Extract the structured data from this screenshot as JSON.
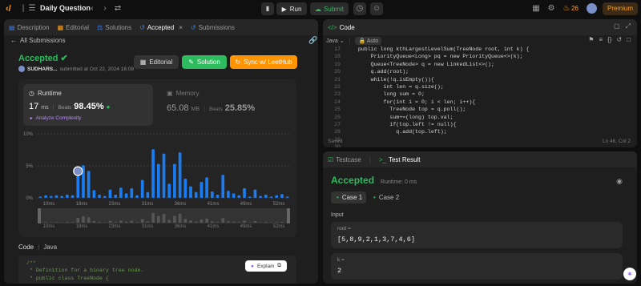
{
  "nav": {
    "title": "Daily Question",
    "run": "Run",
    "submit": "Submit",
    "streak": "26",
    "premium": "Premium"
  },
  "left_tabs": [
    {
      "label": "Description"
    },
    {
      "label": "Editorial"
    },
    {
      "label": "Solutions"
    },
    {
      "label": "Accepted"
    },
    {
      "label": "Submissions"
    }
  ],
  "submission": {
    "back_label": "All Submissions",
    "status": "Accepted",
    "user": "SUDHARS...",
    "submitted": "submitted at Oct 22, 2024 16:08",
    "editorial_btn": "Editorial",
    "solution_btn": "Solution",
    "sync_btn": "Sync w/ LeetHub"
  },
  "runtime": {
    "label": "Runtime",
    "value": "17",
    "unit": "ms",
    "beats_label": "Beats",
    "beats": "98.45%",
    "analyze": "Analyze Complexity"
  },
  "memory": {
    "label": "Memory",
    "value": "65.08",
    "unit": "MB",
    "beats_label": "Beats",
    "beats": "25.85%"
  },
  "chart_data": {
    "type": "bar",
    "ytick_labels": [
      "10%",
      "5%",
      "0%"
    ],
    "ylim": [
      0,
      10
    ],
    "xtick_labels": [
      "10ms",
      "18ms",
      "23ms",
      "31ms",
      "36ms",
      "41ms",
      "49ms",
      "52ms"
    ],
    "values": [
      0.2,
      0.4,
      0.3,
      0.4,
      0.3,
      0.5,
      0.4,
      3.8,
      5.1,
      4.2,
      1.2,
      0.5,
      0.3,
      1.3,
      0.5,
      1.6,
      0.7,
      1.5,
      0.4,
      2.8,
      0.9,
      7.6,
      5.3,
      6.9,
      2.2,
      5.3,
      7.1,
      3.0,
      1.8,
      0.9,
      2.5,
      3.2,
      1.0,
      0.5,
      3.6,
      1.1,
      0.7,
      0.4,
      1.5,
      0.2,
      1.3,
      0.3,
      0.5,
      0.2,
      0.4,
      0.6,
      0.2
    ],
    "highlight_index": 7
  },
  "code_section": {
    "label": "Code",
    "lang": "Java",
    "explain": "Explain",
    "lines": [
      "/**",
      " * Definition for a binary tree node.",
      " * public class TreeNode {"
    ]
  },
  "editor": {
    "title": "Code",
    "lang": "Java",
    "auto": "Auto",
    "saved": "Saved",
    "cursor": "Ln 46, Col 2",
    "line_numbers": [
      "17",
      "18",
      "19",
      "20",
      "21",
      "22",
      "23",
      "24",
      "25",
      "26",
      "27",
      "28",
      "29",
      "30",
      "31"
    ],
    "lines": [
      "    public long kthLargestLevelSum(TreeNode root, int k) {",
      "        PriorityQueue<Long> pq = new PriorityQueue<>(k);",
      "        Queue<TreeNode> q = new LinkedList<>();",
      "        q.add(root);",
      "        while(!q.isEmpty()){",
      "            int len = q.size();",
      "            long sum = 0;",
      "            for(int i = 0; i < len; i++){",
      "              TreeNode top = q.poll();",
      "              sum+=(long) top.val;",
      "              if(top.left != null){",
      "                q.add(top.left);"
    ]
  },
  "testpanel": {
    "tab1": "Testcase",
    "tab2": "Test Result",
    "status": "Accepted",
    "runtime": "Runtime: 0 ms",
    "case1": "Case 1",
    "case2": "Case 2",
    "input_label": "Input",
    "var1_name": "root =",
    "var1_value": "[5,8,9,2,1,3,7,4,6]",
    "var2_name": "k =",
    "var2_value": "2"
  }
}
